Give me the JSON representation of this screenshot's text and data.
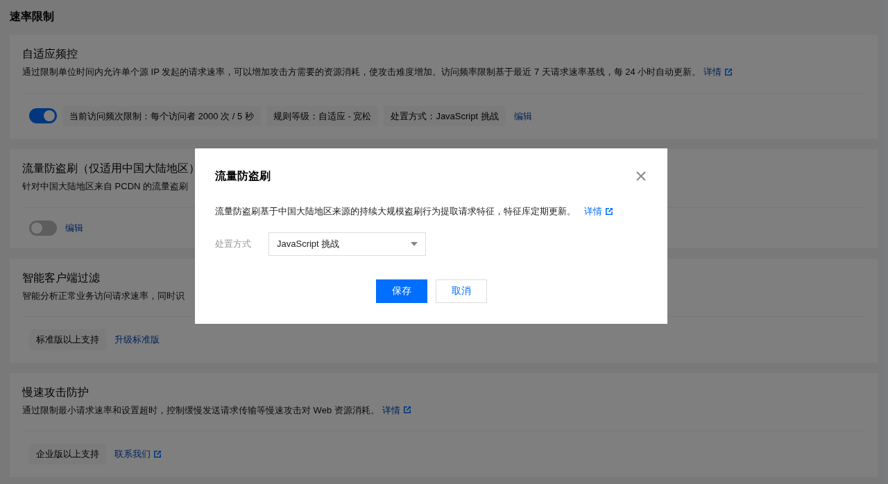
{
  "page_title": "速率限制",
  "sections": [
    {
      "title": "自适应频控",
      "description": "通过限制单位时间内允许单个源 IP 发起的请求速率，可以增加攻击方需要的资源消耗，使攻击难度增加。访问频率限制基于最近 7 天请求速率基线，每 24 小时自动更新。",
      "description_link": "详情",
      "controls": [
        {
          "kind": "switch",
          "on": true
        },
        {
          "kind": "tag",
          "text": "当前访问频次限制：每个访问者 2000 次 / 5 秒"
        },
        {
          "kind": "tag",
          "text": "规则等级：自适应 - 宽松"
        },
        {
          "kind": "tag",
          "text": "处置方式：JavaScript 挑战"
        },
        {
          "kind": "link",
          "text": "编辑",
          "external": false
        }
      ]
    },
    {
      "title": "流量防盗刷（仅适用中国大陆地区）",
      "description": "针对中国大陆地区来自 PCDN 的流量盗刷",
      "controls": [
        {
          "kind": "switch",
          "on": false
        },
        {
          "kind": "link",
          "text": "编辑",
          "external": false
        }
      ]
    },
    {
      "title": "智能客户端过滤",
      "description": "智能分析正常业务访问请求速率，同时识",
      "controls": [
        {
          "kind": "tag",
          "text": "标准版以上支持"
        },
        {
          "kind": "link",
          "text": "升级标准版",
          "external": false
        }
      ]
    },
    {
      "title": "慢速攻击防护",
      "description": "通过限制最小请求速率和设置超时，控制缓慢发送请求传输等慢速攻击对 Web 资源消耗。",
      "description_link": "详情",
      "controls": [
        {
          "kind": "tag",
          "text": "企业版以上支持"
        },
        {
          "kind": "link",
          "text": "联系我们",
          "external": true
        }
      ]
    }
  ],
  "dialog": {
    "title": "流量防盗刷",
    "description": "流量防盗刷基于中国大陆地区来源的持续大规模盗刷行为提取请求特征，特征库定期更新。",
    "description_link": "详情",
    "field_label": "处置方式",
    "select_value": "JavaScript 挑战",
    "buttons": [
      {
        "kind": "primary",
        "label": "保存"
      },
      {
        "kind": "secondary",
        "label": "取消"
      }
    ]
  }
}
